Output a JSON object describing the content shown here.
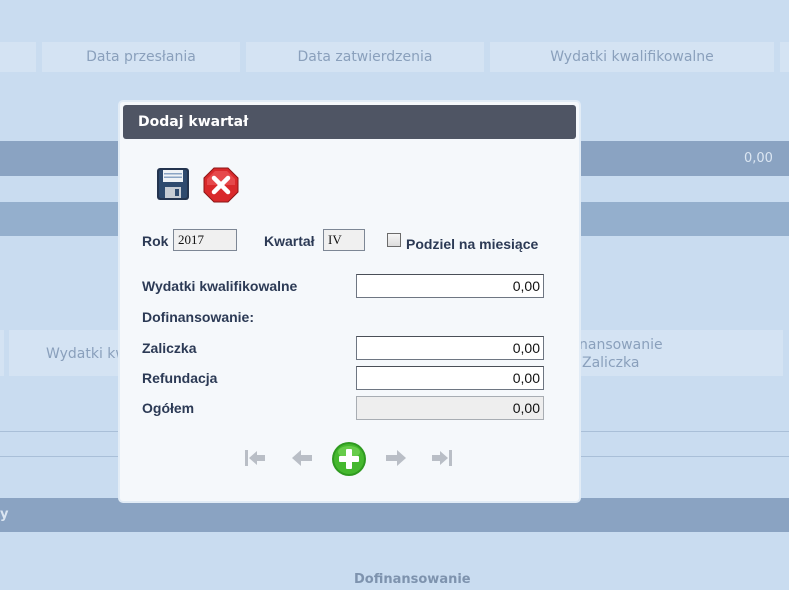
{
  "background": {
    "table_headers": [
      "Data przesłania",
      "Data zatwierdzenia",
      "Wydatki kwalifikowalne"
    ],
    "row_value": "0,00",
    "mid_left_label": "Wydatki kw",
    "mid_right_label_line1": "nansowanie",
    "mid_right_label_line2": "Zaliczka",
    "band_left_text": "y",
    "bottom_label": "Dofinansowanie"
  },
  "modal": {
    "title": "Dodaj kwartał",
    "rok_label": "Rok",
    "rok_value": "2017",
    "kwartal_label": "Kwartał",
    "kwartal_value": "IV",
    "podziel_label": "Podziel na miesiące",
    "wydatki_label": "Wydatki kwalifikowalne",
    "wydatki_value": "0,00",
    "dofinansowanie_label": "Dofinansowanie:",
    "zaliczka_label": "Zaliczka",
    "zaliczka_value": "0,00",
    "refundacja_label": "Refundacja",
    "refundacja_value": "0,00",
    "ogolem_label": "Ogółem",
    "ogolem_value": "0,00"
  },
  "icons": {
    "save": "floppy-disk-icon",
    "cancel": "red-x-icon",
    "first": "first-page-icon",
    "prev": "previous-icon",
    "add": "green-plus-icon",
    "next": "next-icon",
    "last": "last-page-icon"
  },
  "colors": {
    "title_bar": "#4f5564",
    "background": "#c9dcf0",
    "add_green": "#3fae2a",
    "cancel_red": "#d9292b"
  }
}
